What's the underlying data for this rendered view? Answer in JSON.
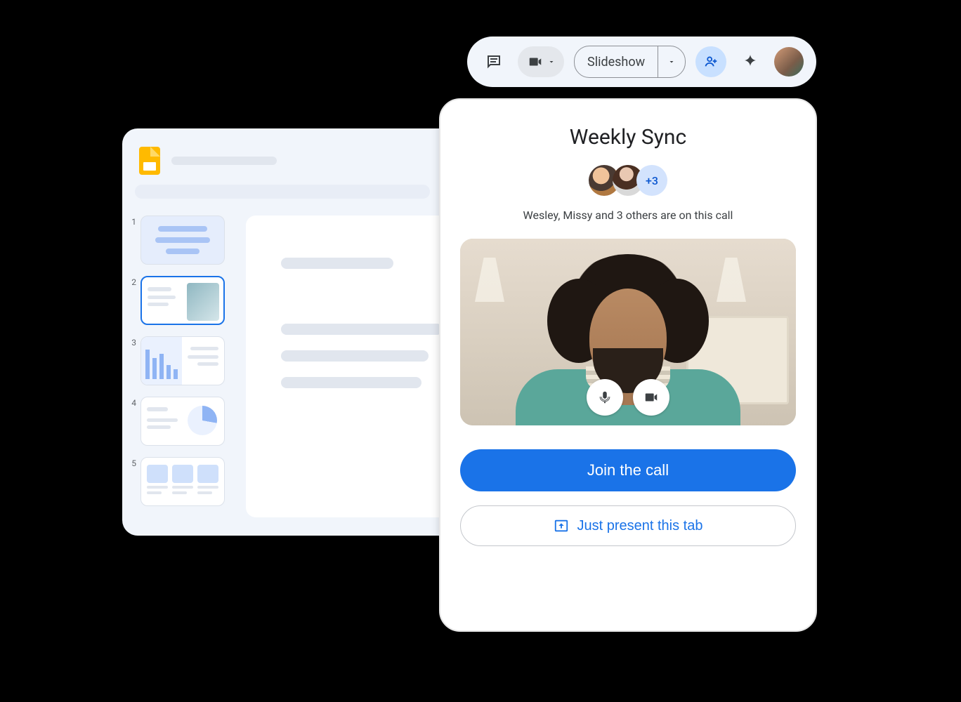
{
  "toolbar": {
    "comment_icon": "comment-icon",
    "video_icon": "video-icon",
    "slideshow_label": "Slideshow",
    "share_icon": "person-add-icon",
    "gemini_icon": "sparkle-icon"
  },
  "slides": {
    "thumbs": [
      {
        "num": "1"
      },
      {
        "num": "2"
      },
      {
        "num": "3"
      },
      {
        "num": "4"
      },
      {
        "num": "5"
      }
    ],
    "selected": 2
  },
  "call": {
    "title": "Weekly Sync",
    "extra_count": "+3",
    "subtitle": "Wesley, Missy and 3 others are on this call",
    "join_label": "Join the call",
    "present_label": "Just present this tab"
  }
}
